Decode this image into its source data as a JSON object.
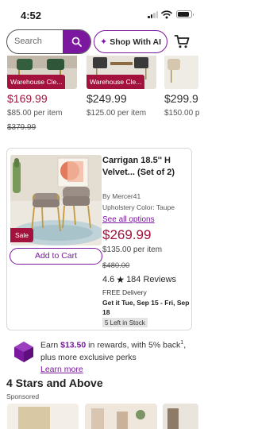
{
  "status_bar": {
    "time": "4:52"
  },
  "header": {
    "search_placeholder": "Search",
    "shop_ai_label": "Shop With AI"
  },
  "carousel": [
    {
      "tag": "Warehouse Cle...",
      "price": "$169.99",
      "per_item": "$85.00 per item",
      "original_price": "$379.99"
    },
    {
      "tag": "Warehouse Cle...",
      "price": "$249.99",
      "per_item": "$125.00 per item",
      "original_price": ""
    },
    {
      "tag": "",
      "price": "$299.9",
      "per_item": "$150.00 p",
      "original_price": ""
    }
  ],
  "product": {
    "badge": "Sale",
    "title": "Carrigan 18.5'' H Velvet... (Set of 2)",
    "brand": "By Mercer41",
    "upholstery": "Upholstery Color: Taupe",
    "see_options": "See all options",
    "price": "$269.99",
    "per_item": "$135.00 per item",
    "original_price": "$480.00",
    "rating": "4.6",
    "reviews": "184 Reviews",
    "shipping": "FREE Delivery",
    "delivery_eta": "Get it Tue, Sep 15 - Fri, Sep 18",
    "stock": "5 Left in Stock",
    "add_to_cart": "Add to Cart"
  },
  "rewards": {
    "prefix": "Earn ",
    "amount": "$13.50",
    "suffix": " in rewards, with 5% back",
    "sup": "1",
    "line2": ", plus more exclusive perks",
    "learn_more": "Learn more"
  },
  "section": {
    "title": "4 Stars and Above",
    "sponsored": "Sponsored"
  },
  "colors": {
    "brand_purple": "#7b189f",
    "sale_red": "#a3123d"
  }
}
